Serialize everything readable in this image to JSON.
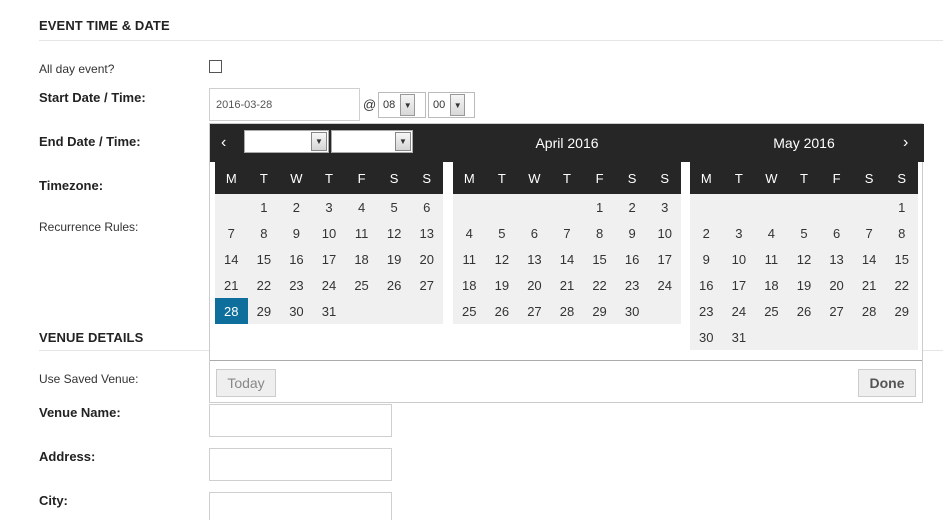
{
  "sections": {
    "event_time": "EVENT TIME & DATE",
    "venue": "VENUE DETAILS"
  },
  "labels": {
    "all_day": "All day event?",
    "start": "Start Date / Time:",
    "end": "End Date / Time:",
    "timezone": "Timezone:",
    "recurrence": "Recurrence Rules:",
    "saved_venue": "Use Saved Venue:",
    "venue_name": "Venue Name:",
    "address": "Address:",
    "city": "City:"
  },
  "start": {
    "date": "2016-03-28",
    "at": "@",
    "hour": "08",
    "minute": "00"
  },
  "datepicker": {
    "prev": "‹",
    "next": "›",
    "month_select": "",
    "year_select": "",
    "weekdays": [
      "M",
      "T",
      "W",
      "T",
      "F",
      "S",
      "S"
    ],
    "months": [
      {
        "title": "",
        "days": [
          "",
          "1",
          "2",
          "3",
          "4",
          "5",
          "6",
          "7",
          "8",
          "9",
          "10",
          "11",
          "12",
          "13",
          "14",
          "15",
          "16",
          "17",
          "18",
          "19",
          "20",
          "21",
          "22",
          "23",
          "24",
          "25",
          "26",
          "27",
          "28",
          "29",
          "30",
          "31"
        ],
        "selected": "28"
      },
      {
        "title": "April 2016",
        "days": [
          "",
          "",
          "",
          "",
          "1",
          "2",
          "3",
          "4",
          "5",
          "6",
          "7",
          "8",
          "9",
          "10",
          "11",
          "12",
          "13",
          "14",
          "15",
          "16",
          "17",
          "18",
          "19",
          "20",
          "21",
          "22",
          "23",
          "24",
          "25",
          "26",
          "27",
          "28",
          "29",
          "30"
        ],
        "selected": ""
      },
      {
        "title": "May 2016",
        "days": [
          "",
          "",
          "",
          "",
          "",
          "",
          "1",
          "2",
          "3",
          "4",
          "5",
          "6",
          "7",
          "8",
          "9",
          "10",
          "11",
          "12",
          "13",
          "14",
          "15",
          "16",
          "17",
          "18",
          "19",
          "20",
          "21",
          "22",
          "23",
          "24",
          "25",
          "26",
          "27",
          "28",
          "29",
          "30",
          "31"
        ],
        "selected": ""
      }
    ],
    "today_label": "Today",
    "done_label": "Done",
    "colors": {
      "header": "#262626",
      "selected": "#0e6f9c",
      "cell_bg": "#f0f0f0"
    }
  }
}
